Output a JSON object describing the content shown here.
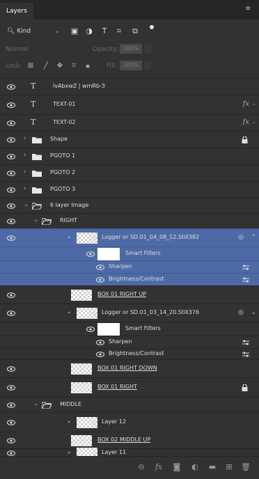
{
  "panel": {
    "tab_label": "Layers",
    "menu_icon": "panel-menu-icon"
  },
  "filter": {
    "kind_label": "Kind",
    "icons": [
      "image-filter-icon",
      "adjustment-filter-icon",
      "type-filter-icon",
      "shape-filter-icon",
      "smart-object-filter-icon"
    ]
  },
  "blend": {
    "mode": "Normal",
    "opacity_label": "Opacity:",
    "opacity_value": "100%"
  },
  "lock": {
    "label": "Lock:",
    "fill_label": "Fill:",
    "fill_value": "100%"
  },
  "layers": [
    {
      "name": "lvAbxwZ | wmRb-3",
      "type": "text"
    },
    {
      "name": "TEXT-01",
      "type": "text",
      "fx": "fx"
    },
    {
      "name": "TEXT-02",
      "type": "text",
      "fx": "fx"
    },
    {
      "name": "Shape",
      "type": "group"
    },
    {
      "name": "PGOTO 1",
      "type": "group"
    },
    {
      "name": "PGOTO 2",
      "type": "group"
    },
    {
      "name": "PGOTO 3",
      "type": "group"
    },
    {
      "name": "6 layer Image",
      "type": "group-open"
    },
    {
      "name": "RIGHT",
      "type": "group-open"
    },
    {
      "name": "Logger or SD.01_04_08_12.Still382",
      "type": "smart",
      "selected": true
    },
    {
      "name": "Smart Filters",
      "type": "smart-filters",
      "selected": true
    },
    {
      "name": "Sharpen",
      "type": "filter",
      "selected": true
    },
    {
      "name": "Brightness/Contrast",
      "type": "filter",
      "selected": true
    },
    {
      "name": "BOX 01 RIGHT UP",
      "type": "pixel"
    },
    {
      "name": "Logger or SD.01_03_14_20.Still376",
      "type": "smart"
    },
    {
      "name": "Smart Filters",
      "type": "smart-filters"
    },
    {
      "name": "Sharpen",
      "type": "filter"
    },
    {
      "name": "Brightness/Contrast",
      "type": "filter"
    },
    {
      "name": "BOX 01 RIGHT DOWN",
      "type": "pixel"
    },
    {
      "name": "BOX 01 RIGHT",
      "type": "pixel"
    },
    {
      "name": "MIDDLE",
      "type": "group-open"
    },
    {
      "name": "Layer 12",
      "type": "smart"
    },
    {
      "name": "BOX 02 MIDDLE UP",
      "type": "pixel"
    },
    {
      "name": "Layer 11",
      "type": "smart"
    }
  ],
  "bottom_icons": [
    "link-layers-icon",
    "fx-icon",
    "add-mask-icon",
    "adjustment-layer-icon",
    "new-group-icon",
    "new-layer-icon",
    "delete-layer-icon"
  ],
  "colors": {
    "panel_bg": "#323232",
    "selection": "#4e6aa6",
    "tab_bg": "#262626"
  }
}
